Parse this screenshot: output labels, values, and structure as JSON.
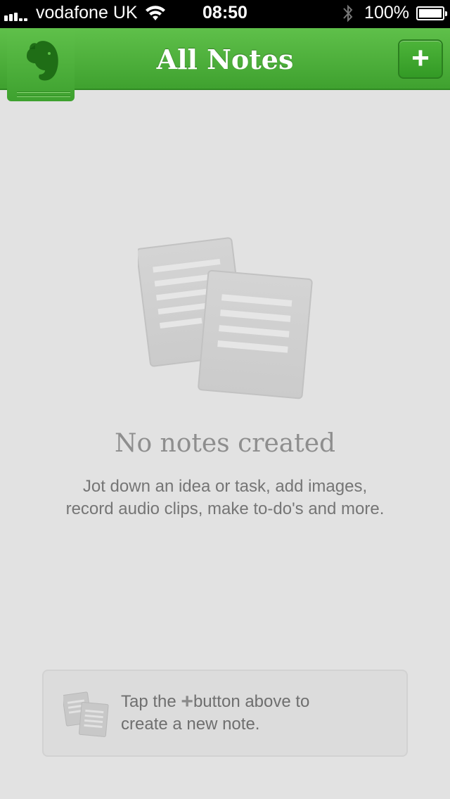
{
  "status_bar": {
    "carrier": "vodafone UK",
    "time": "08:50",
    "battery": "100%",
    "battery_level": 1.0
  },
  "nav": {
    "title": "All Notes",
    "add_label": "+",
    "logo_icon": "evernote-elephant-icon",
    "add_icon": "plus-icon"
  },
  "empty_state": {
    "title": "No notes created",
    "description_line1": "Jot down an idea or task, add images,",
    "description_line2": "record audio clips, make to-do's and more.",
    "icon": "notes-stack-icon"
  },
  "hint": {
    "text_before": "Tap the",
    "plus": "+",
    "text_after": "button above to",
    "line2": "create a new note.",
    "icon": "notes-stack-icon"
  },
  "colors": {
    "brand_green": "#4db43a",
    "background": "#e2e2e2"
  }
}
